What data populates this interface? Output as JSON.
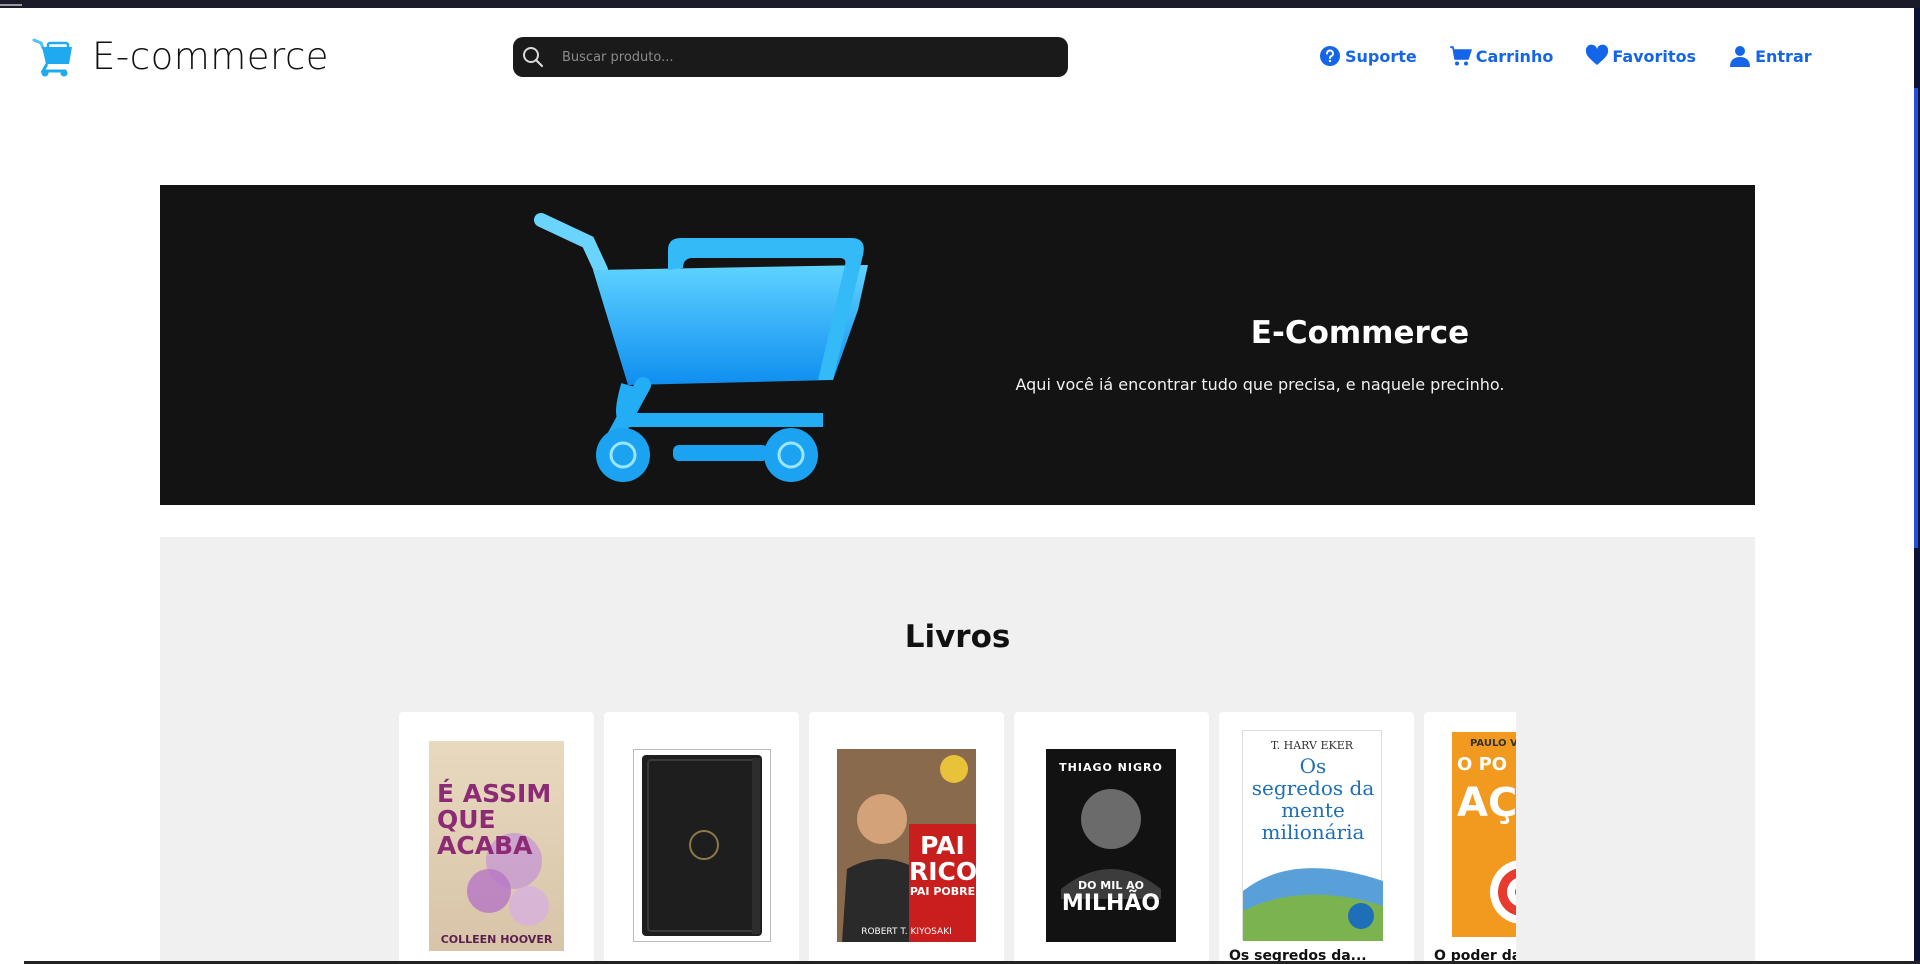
{
  "header": {
    "logo_text": "E-commerce",
    "search_placeholder": "Buscar produto...",
    "nav": {
      "support": "Suporte",
      "cart": "Carrinho",
      "favorites": "Favoritos",
      "login": "Entrar"
    }
  },
  "hero": {
    "title": "E-Commerce",
    "subtitle": "Aqui você iá encontrar tudo que precisa, e naquele precinho."
  },
  "products": {
    "title": "Livros",
    "items": [
      {
        "name": "",
        "cover": {
          "author": "COLLEEN HOOVER",
          "title": "É ASSIM QUE ACABA"
        }
      },
      {
        "name": "",
        "cover": {
          "author": "",
          "title": ""
        }
      },
      {
        "name": "",
        "cover": {
          "author": "ROBERT T. KIYOSAKI",
          "title": "PAI RICO",
          "subtitle": "PAI POBRE"
        }
      },
      {
        "name": "",
        "cover": {
          "author": "THIAGO NIGRO",
          "title": "DO MIL AO",
          "title2": "MILHÃO"
        }
      },
      {
        "name": "Os segredos da...",
        "cover": {
          "author": "T. HARV EKER",
          "title": "Os segredos da mente milionária"
        }
      },
      {
        "name": "O poder da",
        "cover": {
          "author": "PAULO V",
          "title": "O PO",
          "title2": "AÇ"
        }
      }
    ]
  },
  "colors": {
    "accent": "#1565e8",
    "hero_bg": "#131313",
    "section_bg": "#f0f0f0",
    "search_bg": "#1a1a1a"
  },
  "icons": {
    "logo": "shopping-cart-icon",
    "search": "search-icon",
    "support": "question-circle-icon",
    "cart": "cart-icon",
    "favorites": "heart-icon",
    "login": "user-icon"
  }
}
